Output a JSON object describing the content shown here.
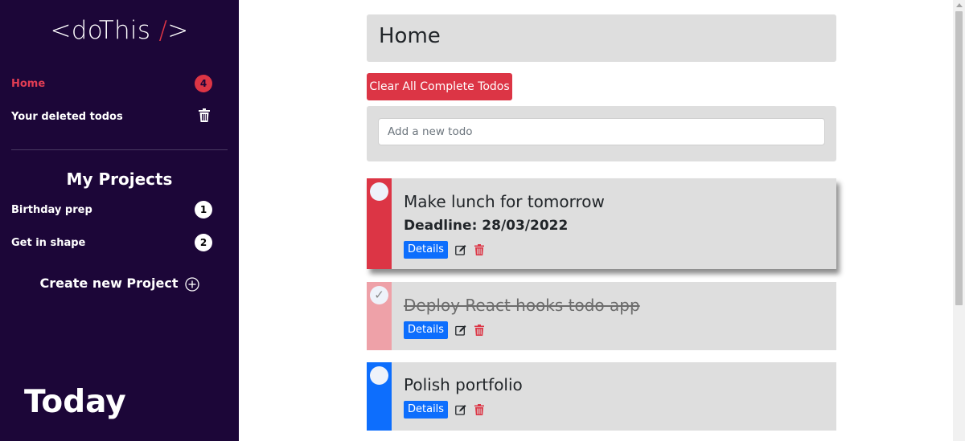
{
  "sidebar": {
    "logo_prefix": "<doThis ",
    "logo_slash": "/",
    "logo_suffix": ">",
    "nav": [
      {
        "label": "Home",
        "badge": "4"
      },
      {
        "label": "Your deleted todos",
        "icon": "trash-icon"
      }
    ],
    "projects_title": "My Projects",
    "projects": [
      {
        "label": "Birthday prep",
        "count": "1"
      },
      {
        "label": "Get in shape",
        "count": "2"
      }
    ],
    "create_project_label": "Create new Project",
    "today_label": "Today"
  },
  "main": {
    "page_title": "Home",
    "clear_button_label": "Clear All Complete Todos",
    "add_todo_placeholder": "Add a new todo",
    "add_todo_value": "",
    "todos": [
      {
        "title": "Make lunch for tomorrow",
        "deadline": "Deadline: 28/03/2022",
        "details_label": "Details",
        "completed": false,
        "priority_color": "#dc3545"
      },
      {
        "title": "Deploy React hooks todo app",
        "details_label": "Details",
        "completed": true,
        "check_mark": "✓",
        "priority_color": "#eea1a8"
      },
      {
        "title": "Polish portfolio",
        "details_label": "Details",
        "completed": false,
        "priority_color": "#0d6efd"
      }
    ]
  },
  "colors": {
    "sidebar_bg": "#1c0638",
    "accent_red": "#dc3545",
    "accent_blue": "#0d6efd",
    "card_bg": "#dedede"
  }
}
